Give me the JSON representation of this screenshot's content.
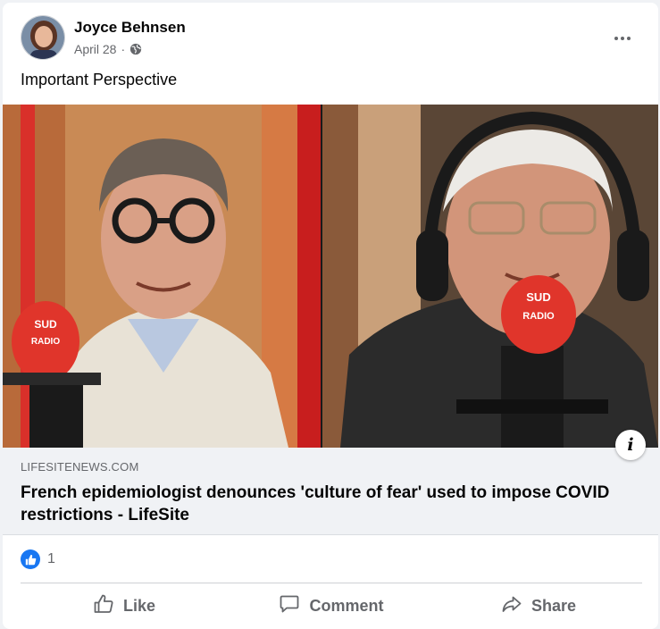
{
  "post": {
    "author": "Joyce Behnsen",
    "date": "April 28",
    "separator": "·",
    "privacy_icon": "globe-icon",
    "text": "Important Perspective"
  },
  "link_preview": {
    "domain": "LIFESITENEWS.COM",
    "title": "French epidemiologist denounces 'culture of fear' used to impose COVID restrictions - LifeSite",
    "info_label": "i",
    "left_mic_label": "SUD RADIO",
    "right_mic_label": "SUD RADIO"
  },
  "reactions": {
    "icon": "like-icon",
    "count": "1"
  },
  "actions": {
    "like": "Like",
    "comment": "Comment",
    "share": "Share"
  },
  "colors": {
    "brand_blue": "#1877f2",
    "secondary_text": "#65676b",
    "mic_red": "#e0352b"
  }
}
